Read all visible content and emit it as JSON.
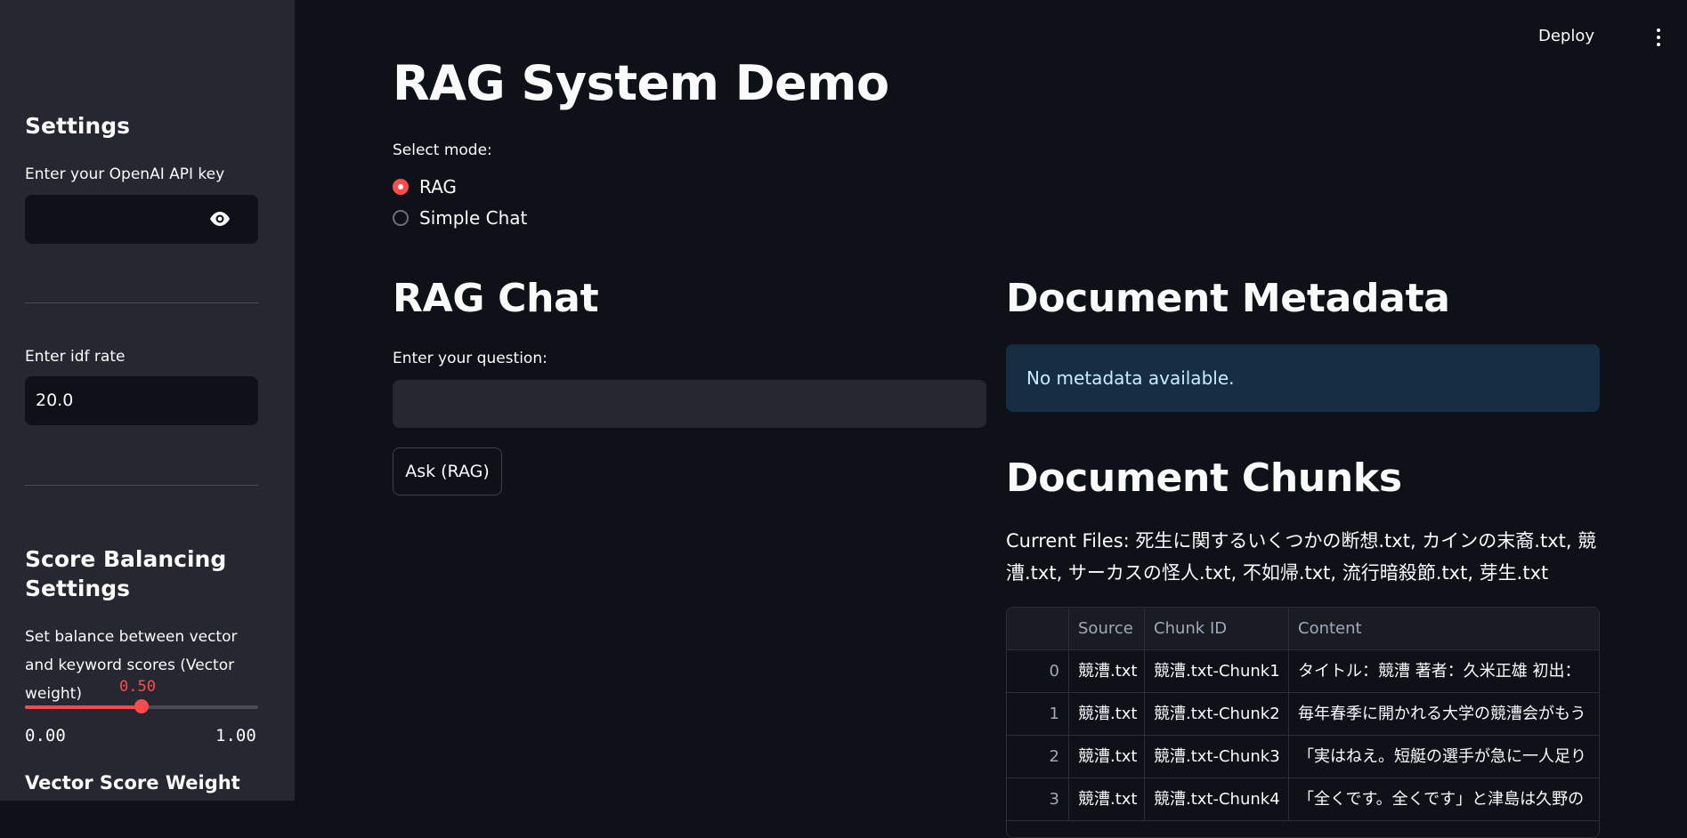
{
  "sidebar": {
    "settings_title": "Settings",
    "api_key_label": "Enter your OpenAI API key",
    "api_key_value": "",
    "idf_label": "Enter idf rate",
    "idf_value": "20.0",
    "score_title": "Score Balancing Settings",
    "balance_label": "Set balance between vector and keyword scores (Vector weight)",
    "balance_value": "0.50",
    "balance_fraction": 0.5,
    "balance_min": "0.00",
    "balance_max": "1.00",
    "vector_weight_title": "Vector Score Weight"
  },
  "header": {
    "deploy_label": "Deploy",
    "menu_icon": "kebab-menu-icon"
  },
  "main": {
    "title": "RAG System Demo",
    "mode_label": "Select mode:",
    "modes": [
      {
        "label": "RAG",
        "selected": true
      },
      {
        "label": "Simple Chat",
        "selected": false
      }
    ],
    "chat_title": "RAG Chat",
    "question_label": "Enter your question:",
    "question_value": "",
    "ask_button": "Ask (RAG)",
    "metadata_title": "Document Metadata",
    "metadata_info": "No metadata available.",
    "chunks_title": "Document Chunks",
    "current_files": "Current Files: 死生に関するいくつかの断想.txt, カインの末裔.txt, 競漕.txt, サーカスの怪人.txt, 不如帰.txt, 流行暗殺節.txt, 芽生.txt",
    "table": {
      "headers": [
        "",
        "Source",
        "Chunk ID",
        "Content"
      ],
      "rows": [
        [
          "0",
          "競漕.txt",
          "競漕.txt-Chunk1",
          "タイトル：競漕 著者：久米正雄 初出："
        ],
        [
          "1",
          "競漕.txt",
          "競漕.txt-Chunk2",
          "毎年春季に開かれる大学の競漕会がもう"
        ],
        [
          "2",
          "競漕.txt",
          "競漕.txt-Chunk3",
          "「実はねえ。短艇の選手が急に一人足り"
        ],
        [
          "3",
          "競漕.txt",
          "競漕.txt-Chunk4",
          "「全くです。全くです」と津島は久野の"
        ]
      ]
    }
  },
  "colors": {
    "accent": "#ff4b4b",
    "sidebar_bg": "#262730",
    "main_bg": "#0e1117",
    "info_bg": "#172d43"
  }
}
